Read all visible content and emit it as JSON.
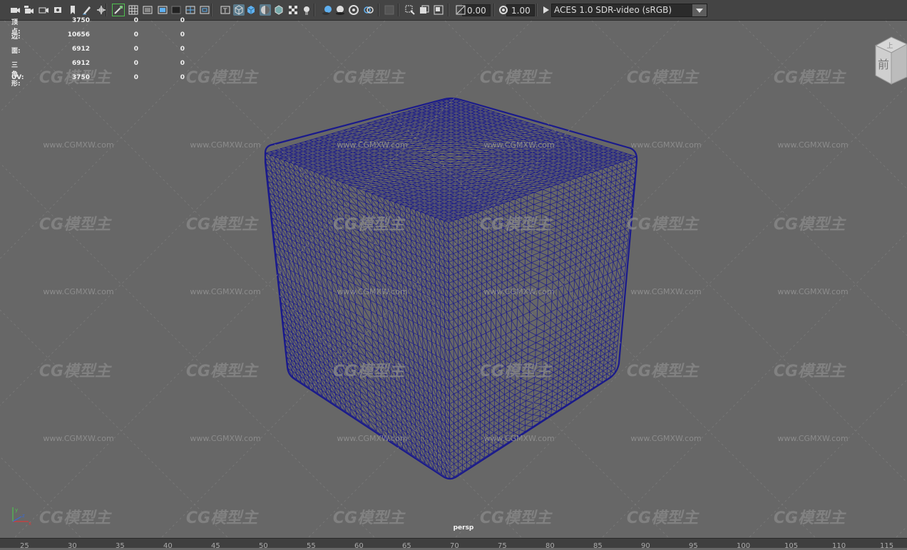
{
  "toolbar": {
    "icons": [
      "camera-icon",
      "camera-attributes-icon",
      "bookmark-camera-icon",
      "image-plane-icon",
      "bookmark-icon",
      "grease-pencil-icon",
      "2d-pan-icon",
      "camera-lock-icon",
      "grid-icon",
      "film-gate-icon",
      "resolution-gate-icon",
      "gate-mask-icon",
      "field-chart-icon",
      "safe-action-icon",
      "safe-title-icon",
      "wireframe-icon",
      "smooth-shade-icon",
      "default-material-icon",
      "wireframe-on-shaded-icon",
      "textured-icon",
      "use-all-lights-icon",
      "shadows-icon",
      "screen-space-ao-icon",
      "motion-blur-icon",
      "multisample-aa-icon",
      "depth-of-field-icon",
      "isolate-select-icon",
      "xray-icon",
      "xray-active-components-icon",
      "xray-joints-icon",
      "exposure-icon",
      "gamma-icon",
      "color-management-icon"
    ],
    "exposure_value": "0.00",
    "gamma_value": "1.00",
    "color_space": "ACES 1.0 SDR-video (sRGB)"
  },
  "hud": {
    "rows": [
      {
        "label": "顶点:",
        "values": [
          "3750",
          "0",
          "0"
        ]
      },
      {
        "label": "边:",
        "values": [
          "10656",
          "0",
          "0"
        ]
      },
      {
        "label": "面:",
        "values": [
          "6912",
          "0",
          "0"
        ]
      },
      {
        "label": "三角形:",
        "values": [
          "6912",
          "0",
          "0"
        ]
      },
      {
        "label": "UV:",
        "values": [
          "3750",
          "0",
          "0"
        ]
      }
    ]
  },
  "viewport": {
    "camera_label": "persp",
    "object": "rounded-cube-wireframe",
    "wire_color": "#1a1a8c",
    "background_color": "#676767"
  },
  "viewcube": {
    "top_label": "上",
    "front_label": "前"
  },
  "watermark": {
    "logo_text": "CG模型主",
    "url_text": "www.CGMXW.com"
  },
  "timeline": {
    "ticks": [
      "25",
      "30",
      "35",
      "40",
      "45",
      "50",
      "55",
      "60",
      "65",
      "70",
      "75",
      "80",
      "85",
      "90",
      "95",
      "100",
      "105",
      "110",
      "115"
    ]
  }
}
